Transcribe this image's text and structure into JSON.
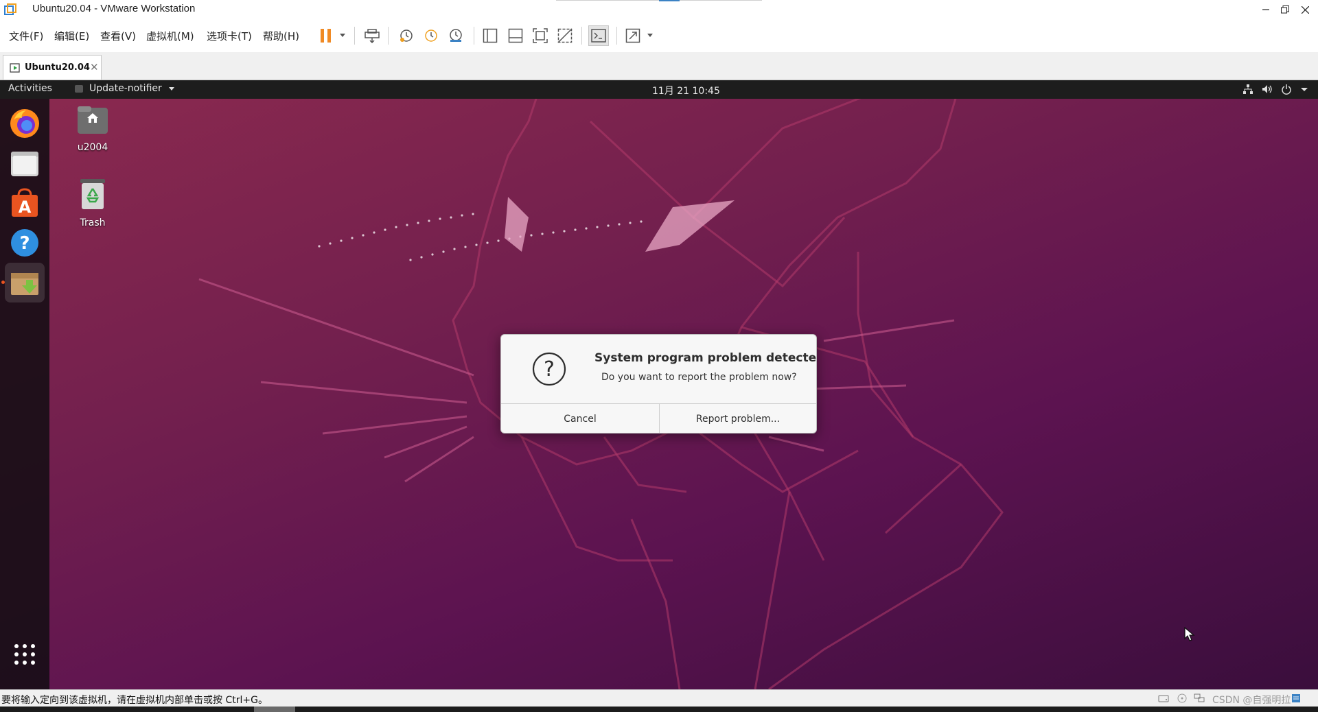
{
  "window": {
    "title": "Ubuntu20.04 - VMware Workstation",
    "controls": [
      "minimize",
      "restore",
      "close"
    ]
  },
  "menu": {
    "items": [
      "文件(F)",
      "编辑(E)",
      "查看(V)",
      "虚拟机(M)",
      "选项卡(T)",
      "帮助(H)"
    ]
  },
  "toolbar": {
    "icons": [
      "pause-icon",
      "send-ctrl-alt-del-icon",
      "snapshot-take-icon",
      "snapshot-revert-icon",
      "snapshot-manager-icon",
      "library-view-icon",
      "thumbnail-view-icon",
      "fullscreen-icon",
      "unity-icon",
      "console-view-icon",
      "stretch-guest-icon"
    ]
  },
  "tab": {
    "label": "Ubuntu20.04"
  },
  "guest": {
    "topbar": {
      "activities": "Activities",
      "app_menu": "Update-notifier",
      "clock": "11月 21  10:45"
    },
    "dock": [
      "firefox-icon",
      "files-icon",
      "software-center-icon",
      "help-icon",
      "software-updater-icon",
      "show-applications-icon"
    ],
    "desktop_icons": [
      {
        "label": "u2004",
        "icon": "home-folder-icon"
      },
      {
        "label": "Trash",
        "icon": "trash-icon"
      }
    ],
    "dialog": {
      "title": "System program problem detected",
      "message": "Do you want to report the problem now?",
      "cancel": "Cancel",
      "report": "Report problem..."
    }
  },
  "statusbar": {
    "text": "要将输入定向到该虚拟机，请在虚拟机内部单击或按 Ctrl+G。",
    "watermark": "CSDN @自强明拉"
  }
}
